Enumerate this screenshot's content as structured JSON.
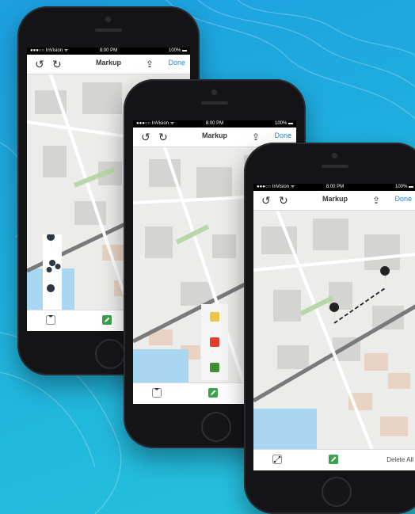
{
  "colors": {
    "accent_blue": "#1e88e5",
    "pencil_green": "#3aa24d",
    "swatch_yellow": "#e8c84a",
    "swatch_red": "#e0402a",
    "swatch_green": "#3f8f35"
  },
  "phones": [
    {
      "status": {
        "carrier": "●●●○○ InVision ᯤ",
        "time": "8:00 PM",
        "battery": "100% ▬"
      },
      "nav": {
        "undo_icon": "undo-icon",
        "redo_icon": "redo-icon",
        "title": "Markup",
        "share_icon": "share-icon",
        "done": "Done"
      },
      "toolbar": {
        "pin_icon": "map-pin-icon",
        "pencil_icon": "pencil-icon"
      }
    },
    {
      "status": {
        "carrier": "●●●○○ InVision ᯤ",
        "time": "8:00 PM",
        "battery": "100% ▬"
      },
      "nav": {
        "undo_icon": "undo-icon",
        "redo_icon": "redo-icon",
        "title": "Markup",
        "share_icon": "share-icon",
        "done": "Done"
      },
      "toolbar": {
        "pin_icon": "map-pin-icon",
        "pencil_icon": "pencil-icon"
      }
    },
    {
      "status": {
        "carrier": "●●●○○ InVision ᯤ",
        "time": "8:00 PM",
        "battery": "100% ▬"
      },
      "nav": {
        "undo_icon": "undo-icon",
        "redo_icon": "redo-icon",
        "title": "Markup",
        "share_icon": "share-icon",
        "done": "Done"
      },
      "toolbar": {
        "measure_icon": "measure-icon",
        "pencil_icon": "pencil-icon",
        "delete_all": "Delete All"
      }
    }
  ]
}
